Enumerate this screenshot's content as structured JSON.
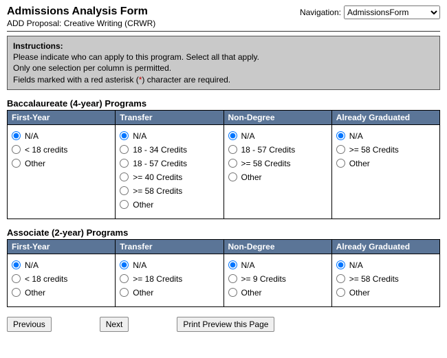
{
  "header": {
    "title": "Admissions Analysis Form",
    "subtitle": "ADD Proposal: Creative Writing (CRWR)",
    "nav_label": "Navigation:",
    "nav_value": "AdmissionsForm"
  },
  "instructions": {
    "heading": "Instructions:",
    "line1": "Please indicate who can apply to this program. Select all that apply.",
    "line2": "Only one selection per column is permitted.",
    "line3_a": "Fields marked with a red asterisk (",
    "line3_star": "*",
    "line3_b": ") character are required."
  },
  "bacc": {
    "title": "Baccalaureate (4-year) Programs",
    "cols": {
      "first_year": {
        "header": "First-Year",
        "options": [
          "N/A",
          "< 18 credits",
          "Other"
        ],
        "selected": "N/A"
      },
      "transfer": {
        "header": "Transfer",
        "options": [
          "N/A",
          "18 - 34 Credits",
          "18 - 57 Credits",
          ">= 40 Credits",
          ">= 58 Credits",
          "Other"
        ],
        "selected": "N/A"
      },
      "non_degree": {
        "header": "Non-Degree",
        "options": [
          "N/A",
          "18 - 57 Credits",
          ">= 58 Credits",
          "Other"
        ],
        "selected": "N/A"
      },
      "already_graduated": {
        "header": "Already Graduated",
        "options": [
          "N/A",
          ">= 58 Credits",
          "Other"
        ],
        "selected": "N/A"
      }
    }
  },
  "assoc": {
    "title": "Associate (2-year) Programs",
    "cols": {
      "first_year": {
        "header": "First-Year",
        "options": [
          "N/A",
          "< 18 credits",
          "Other"
        ],
        "selected": "N/A"
      },
      "transfer": {
        "header": "Transfer",
        "options": [
          "N/A",
          ">= 18 Credits",
          "Other"
        ],
        "selected": "N/A"
      },
      "non_degree": {
        "header": "Non-Degree",
        "options": [
          "N/A",
          ">= 9 Credits",
          "Other"
        ],
        "selected": "N/A"
      },
      "already_graduated": {
        "header": "Already Graduated",
        "options": [
          "N/A",
          ">= 58 Credits",
          "Other"
        ],
        "selected": "N/A"
      }
    }
  },
  "buttons": {
    "previous": "Previous",
    "next": "Next",
    "print": "Print Preview this Page"
  }
}
